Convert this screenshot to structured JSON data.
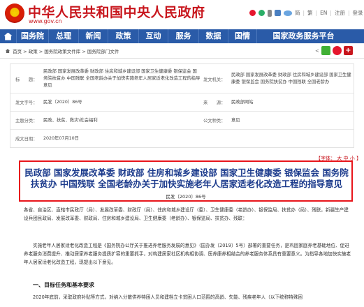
{
  "header": {
    "site_title": "中华人民共和国中央人民政府",
    "site_url": "www.gov.cn",
    "top_links": {
      "simplified": "简",
      "traditional": "繁",
      "en": "EN",
      "login": "注册",
      "register": "登录"
    }
  },
  "nav": {
    "items": [
      "国务院",
      "总理",
      "新闻",
      "政策",
      "互动",
      "服务",
      "数据",
      "国情"
    ],
    "special": "国家政务服务平台"
  },
  "breadcrumb": {
    "items": [
      "首页",
      "政策",
      "国务院政策文件库",
      "国务院部门文件"
    ],
    "separator": ">"
  },
  "info": {
    "title_label": "标　　题：",
    "title_left": "民政部  国家发展改革委  财政部  住房和城乡建设部  国家卫生健康委  银保监会  国务院扶贫办  中国残联  全国老龄办关于加快实施老年人居家适老化改造工程的指导意见",
    "issuer_label": "发文机关：",
    "issuer": "民政部  国家发展改革委  财政部  住房和城乡建设部  国家卫生健康委  银保监会  国务院扶贫办  中国残联  全国老龄办",
    "docno_label": "发文字号：",
    "docno": "民发〔2020〕86号",
    "source_label": "来　　源：",
    "source": "民政部网站",
    "theme_label": "主题分类：",
    "theme": "民政、扶贫、救灾\\社会福利",
    "doctype_label": "公文种类：",
    "doctype": "意见",
    "date_label": "成文日期：",
    "date": "2020年07月10日"
  },
  "fontsize": {
    "label_pre": "【字体：",
    "large": "大",
    "medium": "中",
    "small": "小",
    "label_post": "】"
  },
  "article": {
    "title_line1": "民政部  国家发展改革委  财政部  住房和城乡建设部  国家卫生健康委  银保监会  国务院",
    "title_line2": "扶贫办  中国残联  全国老龄办关于加快实施老年人居家适老化改造工程的指导意见",
    "docno": "民发〔2020〕86号",
    "p1": "各省、自治区、直辖市民政厅（局）、发展改革委、财政厅（局）、住房和城乡建设厅（委）、卫生健康委（老龄办）、银保监局、扶贫办（局）、残联，新疆生产建设兵团民政局、发展改革委、财政局、住房和城乡建设局、卫生健康委（老龄办）、银保监局、扶贫办、残联：",
    "p2": "实施老年人居家适老化改造工程是《国务院办公厅关于推进养老服务发展的意见》（国办发〔2019〕5号）部署的重要任务，是巩固家庭养老基础地位、促进养老服务消费提升、推动居家养老服务提质扩容的重要抓手，对构建居家社区机构相协调、医养康养相结合的养老服务体系具有重要意义。为指导各地加快实施老年人居家适老化改造工程，现提出以下意见。",
    "h1": "一、目标任务和基本要求",
    "p3": "2020年底前，采取政府补贴等方式，对纳入分散供养特困人员和建档立卡贫困人口范围的高龄、失能、残疾老年人（以下统称特殊困"
  }
}
